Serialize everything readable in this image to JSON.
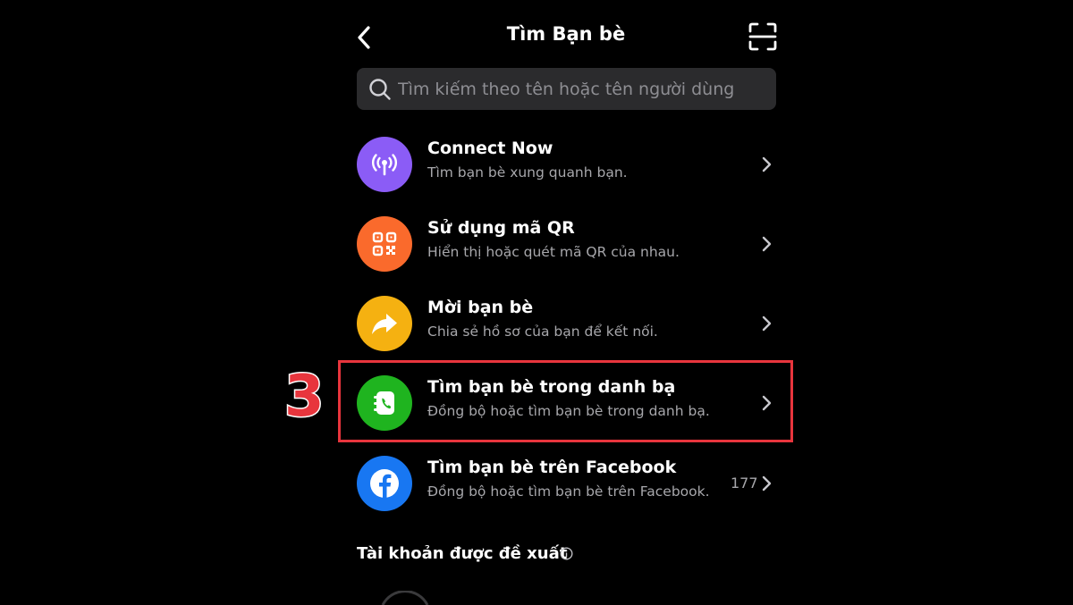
{
  "header": {
    "title": "Tìm Bạn bè",
    "back_icon": "chevron-left-icon",
    "scan_icon": "scan-icon"
  },
  "search": {
    "placeholder": "Tìm kiếm theo tên hoặc tên người dùng",
    "value": ""
  },
  "rows": [
    {
      "title": "Connect Now",
      "subtitle": "Tìm bạn bè xung quanh bạn.",
      "icon": "broadcast-icon",
      "color": "#8b5cf6"
    },
    {
      "title": "Sử dụng mã QR",
      "subtitle": "Hiển thị hoặc quét mã QR của nhau.",
      "icon": "qr-code-icon",
      "color": "#fa6a2c"
    },
    {
      "title": "Mời bạn bè",
      "subtitle": "Chia sẻ hồ sơ của bạn để kết nối.",
      "icon": "share-arrow-icon",
      "color": "#f5b111"
    },
    {
      "title": "Tìm bạn bè trong danh bạ",
      "subtitle": "Đồng bộ hoặc tìm bạn bè trong danh bạ.",
      "icon": "contacts-icon",
      "color": "#1fb41f"
    },
    {
      "title": "Tìm bạn bè trên Facebook",
      "subtitle": "Đồng bộ hoặc tìm bạn bè trên Facebook.",
      "icon": "facebook-icon",
      "color": "#1877f2",
      "count": "177"
    }
  ],
  "annotation": {
    "step": "3",
    "color": "#e8353d"
  },
  "suggested": {
    "title": "Tài khoản được đề xuất",
    "icon": "info-icon"
  }
}
